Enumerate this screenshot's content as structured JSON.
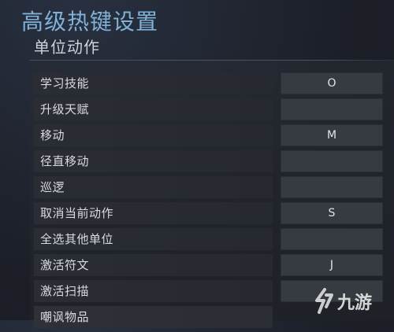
{
  "header": {
    "title": "高级热键设置",
    "section": "单位动作"
  },
  "hotkeys": [
    {
      "label": "学习技能",
      "key": "O"
    },
    {
      "label": "升级天赋",
      "key": ""
    },
    {
      "label": "移动",
      "key": "M"
    },
    {
      "label": "径直移动",
      "key": ""
    },
    {
      "label": "巡逻",
      "key": ""
    },
    {
      "label": "取消当前动作",
      "key": "S"
    },
    {
      "label": "全选其他单位",
      "key": ""
    },
    {
      "label": "激活符文",
      "key": "J"
    },
    {
      "label": "激活扫描",
      "key": ""
    },
    {
      "label": "嘲讽物品",
      "key": ""
    }
  ],
  "watermark": {
    "text": "九游"
  }
}
